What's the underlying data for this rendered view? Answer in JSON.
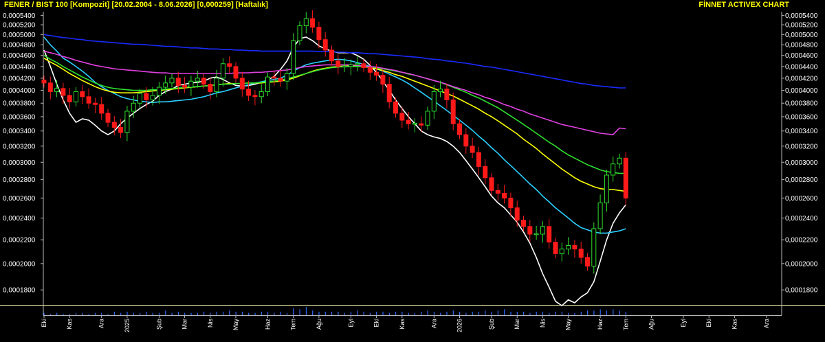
{
  "header": {
    "title": "FENER / BIST 100 [Kompozit]  [20.02.2004 - 8.06.2026]  [0,000259]  [Haftalık]",
    "brand": "FİNNET ACTIVEX CHART"
  },
  "colors": {
    "background": "#000000",
    "text": "#ffffff",
    "title": "#ffff00",
    "candle_up": "#2ee02e",
    "candle_down": "#ff1a1a",
    "volume": "#2f6bff",
    "frame": "#d8d8a0"
  },
  "chart_data": {
    "type": "candlestick",
    "scale": "log",
    "ylim": [
      0.00017,
      0.000548
    ],
    "y_ticks": [
      {
        "value": 0.00054,
        "label": "0,0005400"
      },
      {
        "value": 0.00052,
        "label": "0,0005200"
      },
      {
        "value": 0.0005,
        "label": "0,0005000"
      },
      {
        "value": 0.00048,
        "label": "0,0004800"
      },
      {
        "value": 0.00046,
        "label": "0,0004600"
      },
      {
        "value": 0.00044,
        "label": "0,0004400"
      },
      {
        "value": 0.00042,
        "label": "0,0004200"
      },
      {
        "value": 0.0004,
        "label": "0,0004000"
      },
      {
        "value": 0.00038,
        "label": "0,0003800"
      },
      {
        "value": 0.00036,
        "label": "0,0003600"
      },
      {
        "value": 0.00034,
        "label": "0,0003400"
      },
      {
        "value": 0.00032,
        "label": "0,0003200"
      },
      {
        "value": 0.0003,
        "label": "0,0003000"
      },
      {
        "value": 0.00028,
        "label": "0,0002800"
      },
      {
        "value": 0.00026,
        "label": "0,0002600"
      },
      {
        "value": 0.00024,
        "label": "0,0002400"
      },
      {
        "value": 0.00022,
        "label": "0,0002200"
      },
      {
        "value": 0.0002,
        "label": "0,0002000"
      },
      {
        "value": 0.00018,
        "label": "0,0001800"
      }
    ],
    "x_labels": [
      {
        "week": 0,
        "label": "Eki"
      },
      {
        "week": 4,
        "label": "Kas"
      },
      {
        "week": 9,
        "label": "Ara"
      },
      {
        "week": 13,
        "label": "2025"
      },
      {
        "week": 18,
        "label": "Şub"
      },
      {
        "week": 22,
        "label": "Mar"
      },
      {
        "week": 26,
        "label": "Nis"
      },
      {
        "week": 30,
        "label": "May"
      },
      {
        "week": 35,
        "label": "Haz"
      },
      {
        "week": 39,
        "label": "Tem"
      },
      {
        "week": 43,
        "label": "Ağu"
      },
      {
        "week": 48,
        "label": "Eyl"
      },
      {
        "week": 52,
        "label": "Eki"
      },
      {
        "week": 56,
        "label": "Kas"
      },
      {
        "week": 61,
        "label": "Ara"
      },
      {
        "week": 65,
        "label": "2026"
      },
      {
        "week": 70,
        "label": "Şub"
      },
      {
        "week": 74,
        "label": "Mar"
      },
      {
        "week": 78,
        "label": "Nis"
      },
      {
        "week": 82,
        "label": "May"
      },
      {
        "week": 87,
        "label": "Haz"
      },
      {
        "week": 91,
        "label": "Tem"
      },
      {
        "week": 95,
        "label": "Ağu"
      },
      {
        "week": 100,
        "label": "Eyl"
      },
      {
        "week": 104,
        "label": "Eki"
      },
      {
        "week": 108,
        "label": "Kas"
      },
      {
        "week": 113,
        "label": "Ara"
      }
    ],
    "close": [
      0.000412,
      0.000398,
      0.000403,
      0.000392,
      0.000382,
      0.000398,
      0.00039,
      0.00038,
      0.000378,
      0.000365,
      0.000352,
      0.000345,
      0.000338,
      0.000368,
      0.00038,
      0.000395,
      0.000385,
      0.000392,
      0.000405,
      0.000412,
      0.00042,
      0.000408,
      0.000405,
      0.000415,
      0.00042,
      0.00041,
      0.000398,
      0.00042,
      0.000445,
      0.00044,
      0.00042,
      0.000402,
      0.000392,
      0.00039,
      0.000398,
      0.000422,
      0.00042,
      0.000415,
      0.000428,
      0.000488,
      0.000518,
      0.000533,
      0.000515,
      0.00049,
      0.00047,
      0.00045,
      0.00044,
      0.00044,
      0.000443,
      0.000445,
      0.000438,
      0.00043,
      0.000425,
      0.00041,
      0.000382,
      0.000365,
      0.000355,
      0.00035,
      0.00035,
      0.000348,
      0.000368,
      0.000398,
      0.000402,
      0.000385,
      0.00035,
      0.000335,
      0.00032,
      0.000312,
      0.000295,
      0.000282,
      0.000268,
      0.000265,
      0.00026,
      0.00025,
      0.000238,
      0.000232,
      0.000225,
      0.000225,
      0.000232,
      0.000218,
      0.000208,
      0.000212,
      0.000215,
      0.000212,
      0.000205,
      0.000198,
      0.00023,
      0.000255,
      0.000285,
      0.000298,
      0.000305,
      0.00026
    ],
    "volume": [
      2,
      1,
      2,
      1,
      1,
      2,
      2,
      1,
      2,
      2,
      1,
      3,
      2,
      3,
      2,
      2,
      3,
      2,
      2,
      4,
      2,
      3,
      2,
      2,
      2,
      3,
      2,
      3,
      3,
      4,
      3,
      3,
      2,
      2,
      3,
      3,
      2,
      3,
      2,
      6,
      5,
      7,
      4,
      3,
      3,
      3,
      3,
      2,
      3,
      4,
      3,
      2,
      3,
      3,
      2,
      3,
      3,
      2,
      2,
      3,
      4,
      3,
      2,
      3,
      4,
      3,
      2,
      3,
      3,
      4,
      3,
      4,
      5,
      3,
      3,
      3,
      2,
      3,
      3,
      2,
      3,
      3,
      2,
      2,
      3,
      4,
      4,
      5,
      4,
      5,
      4,
      3
    ],
    "moving_averages": [
      {
        "color": "#ffffff",
        "values": [
          0.00047,
          0.00044,
          0.00041,
          0.000385,
          0.000365,
          0.000352,
          0.000357,
          0.000355,
          0.000348,
          0.00034,
          0.000335,
          0.00034,
          0.00035,
          0.000358,
          0.000365,
          0.000372,
          0.000378,
          0.000383,
          0.000392,
          0.000398,
          0.000402,
          0.000408,
          0.00041,
          0.000412,
          0.000413,
          0.000415,
          0.00042,
          0.000422,
          0.000418,
          0.000412,
          0.000408,
          0.000407,
          0.000408,
          0.00041,
          0.000413,
          0.000417,
          0.000423,
          0.000435,
          0.00045,
          0.000475,
          0.000492,
          0.000495,
          0.000488,
          0.000478,
          0.000472,
          0.000468,
          0.000465,
          0.000465,
          0.000465,
          0.00046,
          0.000453,
          0.000442,
          0.00043,
          0.000415,
          0.0004,
          0.000385,
          0.000372,
          0.00036,
          0.00035,
          0.00034,
          0.000335,
          0.000332,
          0.00033,
          0.000326,
          0.00032,
          0.000312,
          0.000302,
          0.000292,
          0.000282,
          0.000272,
          0.000262,
          0.000255,
          0.00025,
          0.000243,
          0.000236,
          0.000227,
          0.000217,
          0.000205,
          0.000192,
          0.000182,
          0.000172,
          0.000169,
          0.000173,
          0.000171,
          0.000175,
          0.000178,
          0.000186,
          0.000202,
          0.00022,
          0.000235,
          0.000245,
          0.000253
        ]
      },
      {
        "color": "#2ad0ff",
        "values": [
          0.000495,
          0.00048,
          0.000468,
          0.000455,
          0.000448,
          0.00044,
          0.000432,
          0.000423,
          0.000413,
          0.000406,
          0.0004,
          0.000395,
          0.00039,
          0.000387,
          0.000385,
          0.000383,
          0.000382,
          0.000381,
          0.000382,
          0.000382,
          0.000383,
          0.000384,
          0.000385,
          0.000386,
          0.000388,
          0.00039,
          0.000393,
          0.000396,
          0.000398,
          0.000401,
          0.000404,
          0.000407,
          0.000409,
          0.000412,
          0.000414,
          0.000416,
          0.000418,
          0.00042,
          0.000425,
          0.000432,
          0.000438,
          0.000443,
          0.000446,
          0.000448,
          0.00045,
          0.000452,
          0.000453,
          0.000452,
          0.00045,
          0.000447,
          0.000444,
          0.00044,
          0.000436,
          0.000432,
          0.000427,
          0.000422,
          0.000417,
          0.000411,
          0.000404,
          0.000397,
          0.00039,
          0.000383,
          0.000376,
          0.000369,
          0.000362,
          0.000355,
          0.000348,
          0.000341,
          0.000333,
          0.000326,
          0.000318,
          0.000311,
          0.000303,
          0.000296,
          0.000289,
          0.000282,
          0.000275,
          0.000269,
          0.000262,
          0.000256,
          0.00025,
          0.000245,
          0.00024,
          0.000235,
          0.000231,
          0.000229,
          0.000227,
          0.000226,
          0.000226,
          0.000227,
          0.000228,
          0.00023
        ]
      },
      {
        "color": "#ffff00",
        "values": [
          0.000455,
          0.000448,
          0.000442,
          0.000435,
          0.000428,
          0.000422,
          0.000416,
          0.000411,
          0.000406,
          0.000402,
          0.000399,
          0.000397,
          0.000396,
          0.000396,
          0.000396,
          0.000397,
          0.000398,
          0.000399,
          0.0004,
          0.000401,
          0.000402,
          0.000403,
          0.000404,
          0.000405,
          0.000406,
          0.000407,
          0.000408,
          0.000409,
          0.00041,
          0.000411,
          0.000411,
          0.000411,
          0.000412,
          0.000412,
          0.000412,
          0.000413,
          0.000414,
          0.000415,
          0.000417,
          0.00042,
          0.000424,
          0.000428,
          0.000432,
          0.000435,
          0.000437,
          0.000439,
          0.00044,
          0.000441,
          0.000441,
          0.000441,
          0.00044,
          0.000438,
          0.000436,
          0.000433,
          0.00043,
          0.000426,
          0.000423,
          0.000419,
          0.000415,
          0.000411,
          0.000407,
          0.000403,
          0.000399,
          0.000395,
          0.000391,
          0.000386,
          0.000381,
          0.000376,
          0.000371,
          0.000365,
          0.00036,
          0.000354,
          0.000348,
          0.000342,
          0.000336,
          0.000329,
          0.000323,
          0.000317,
          0.00031,
          0.000304,
          0.000298,
          0.000292,
          0.000287,
          0.000282,
          0.000278,
          0.000275,
          0.000272,
          0.00027,
          0.000269,
          0.000269,
          0.000268,
          0.000267
        ]
      },
      {
        "color": "#2ee02e",
        "values": [
          0.00046,
          0.000453,
          0.000447,
          0.00044,
          0.000434,
          0.000428,
          0.000422,
          0.000417,
          0.000412,
          0.000408,
          0.000405,
          0.000403,
          0.000402,
          0.000401,
          0.0004,
          0.0004,
          0.0004,
          0.000401,
          0.000401,
          0.000402,
          0.000403,
          0.000404,
          0.000405,
          0.000406,
          0.000406,
          0.000407,
          0.000408,
          0.000409,
          0.00041,
          0.00041,
          0.000411,
          0.000411,
          0.000412,
          0.000412,
          0.000413,
          0.000414,
          0.000415,
          0.000417,
          0.000419,
          0.000422,
          0.000425,
          0.000428,
          0.000431,
          0.000434,
          0.000436,
          0.000438,
          0.000439,
          0.00044,
          0.00044,
          0.00044,
          0.00044,
          0.000439,
          0.000438,
          0.000436,
          0.000434,
          0.000432,
          0.00043,
          0.000427,
          0.000425,
          0.000422,
          0.000419,
          0.000416,
          0.000413,
          0.000409,
          0.000405,
          0.000401,
          0.000397,
          0.000392,
          0.000388,
          0.000383,
          0.000378,
          0.000373,
          0.000367,
          0.000361,
          0.000355,
          0.000349,
          0.000343,
          0.000337,
          0.000331,
          0.000325,
          0.00032,
          0.000314,
          0.000309,
          0.000305,
          0.000301,
          0.000297,
          0.000294,
          0.000291,
          0.000289,
          0.000288,
          0.000287,
          0.000287
        ]
      },
      {
        "color": "#e040e0",
        "values": [
          0.000468,
          0.000465,
          0.000462,
          0.000458,
          0.000455,
          0.000451,
          0.000448,
          0.000445,
          0.000442,
          0.00044,
          0.000438,
          0.000436,
          0.000435,
          0.000434,
          0.000433,
          0.000432,
          0.000431,
          0.00043,
          0.000429,
          0.000429,
          0.000428,
          0.000428,
          0.000428,
          0.000428,
          0.000428,
          0.000428,
          0.000428,
          0.000428,
          0.000428,
          0.000428,
          0.000429,
          0.000429,
          0.000429,
          0.00043,
          0.00043,
          0.000431,
          0.000432,
          0.000433,
          0.000434,
          0.000436,
          0.000438,
          0.00044,
          0.000441,
          0.000442,
          0.000443,
          0.000443,
          0.000443,
          0.000443,
          0.000443,
          0.000442,
          0.000441,
          0.00044,
          0.000439,
          0.000437,
          0.000435,
          0.000433,
          0.00043,
          0.000428,
          0.000425,
          0.000422,
          0.000419,
          0.000416,
          0.000413,
          0.00041,
          0.000406,
          0.000403,
          0.0004,
          0.000396,
          0.000393,
          0.000389,
          0.000386,
          0.000382,
          0.000378,
          0.000375,
          0.000371,
          0.000368,
          0.000364,
          0.000361,
          0.000358,
          0.000355,
          0.000352,
          0.000349,
          0.000347,
          0.000345,
          0.000343,
          0.000341,
          0.000339,
          0.000337,
          0.000336,
          0.000335,
          0.000344,
          0.000343
        ]
      },
      {
        "color": "#1a2bff",
        "values": [
          0.0005,
          0.000498,
          0.000496,
          0.000494,
          0.000493,
          0.000491,
          0.00049,
          0.000488,
          0.000487,
          0.000486,
          0.000485,
          0.000484,
          0.000483,
          0.000482,
          0.000481,
          0.000481,
          0.00048,
          0.000479,
          0.000478,
          0.000477,
          0.000477,
          0.000476,
          0.000475,
          0.000474,
          0.000474,
          0.000473,
          0.000472,
          0.000472,
          0.000471,
          0.000471,
          0.00047,
          0.00047,
          0.000469,
          0.000469,
          0.000468,
          0.000468,
          0.000468,
          0.000468,
          0.000468,
          0.000468,
          0.000468,
          0.000468,
          0.000468,
          0.000467,
          0.000467,
          0.000467,
          0.000466,
          0.000466,
          0.000465,
          0.000465,
          0.000464,
          0.000463,
          0.000463,
          0.000462,
          0.000461,
          0.00046,
          0.000459,
          0.000458,
          0.000457,
          0.000456,
          0.000454,
          0.000453,
          0.000452,
          0.00045,
          0.000449,
          0.000447,
          0.000446,
          0.000444,
          0.000442,
          0.00044,
          0.000439,
          0.000437,
          0.000435,
          0.000433,
          0.000431,
          0.000429,
          0.000427,
          0.000425,
          0.000423,
          0.000421,
          0.000419,
          0.000417,
          0.000415,
          0.000413,
          0.000411,
          0.00041,
          0.000408,
          0.000407,
          0.000406,
          0.000405,
          0.000404,
          0.000404
        ]
      }
    ]
  }
}
